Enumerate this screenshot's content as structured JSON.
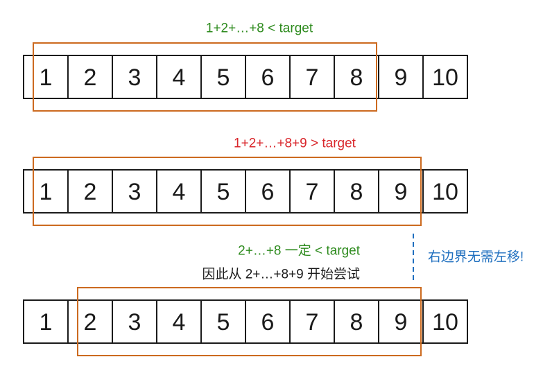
{
  "colors": {
    "cell_stroke": "#1a1a1a",
    "window_stroke": "#cc6a1f",
    "green": "#2e8b1e",
    "red": "#d9262b",
    "black": "#1a1a1a",
    "blue": "#1f6fbf"
  },
  "rows": [
    {
      "cells": [
        "1",
        "2",
        "3",
        "4",
        "5",
        "6",
        "7",
        "8",
        "9",
        "10"
      ],
      "window": {
        "start": 1,
        "end": 8
      },
      "captions": [
        {
          "text": "1+2+…+8 < target",
          "color": "green"
        }
      ]
    },
    {
      "cells": [
        "1",
        "2",
        "3",
        "4",
        "5",
        "6",
        "7",
        "8",
        "9",
        "10"
      ],
      "window": {
        "start": 1,
        "end": 9
      },
      "captions": [
        {
          "text": "1+2+…+8+9 > target",
          "color": "red"
        }
      ]
    },
    {
      "cells": [
        "1",
        "2",
        "3",
        "4",
        "5",
        "6",
        "7",
        "8",
        "9",
        "10"
      ],
      "window": {
        "start": 2,
        "end": 9
      },
      "captions": [
        {
          "text": "2+…+8 一定 < target",
          "color": "green"
        },
        {
          "text": "因此从  2+…+8+9 开始尝试",
          "color": "black"
        }
      ]
    }
  ],
  "side_note": {
    "text": "右边界无需左移!",
    "color": "blue"
  }
}
